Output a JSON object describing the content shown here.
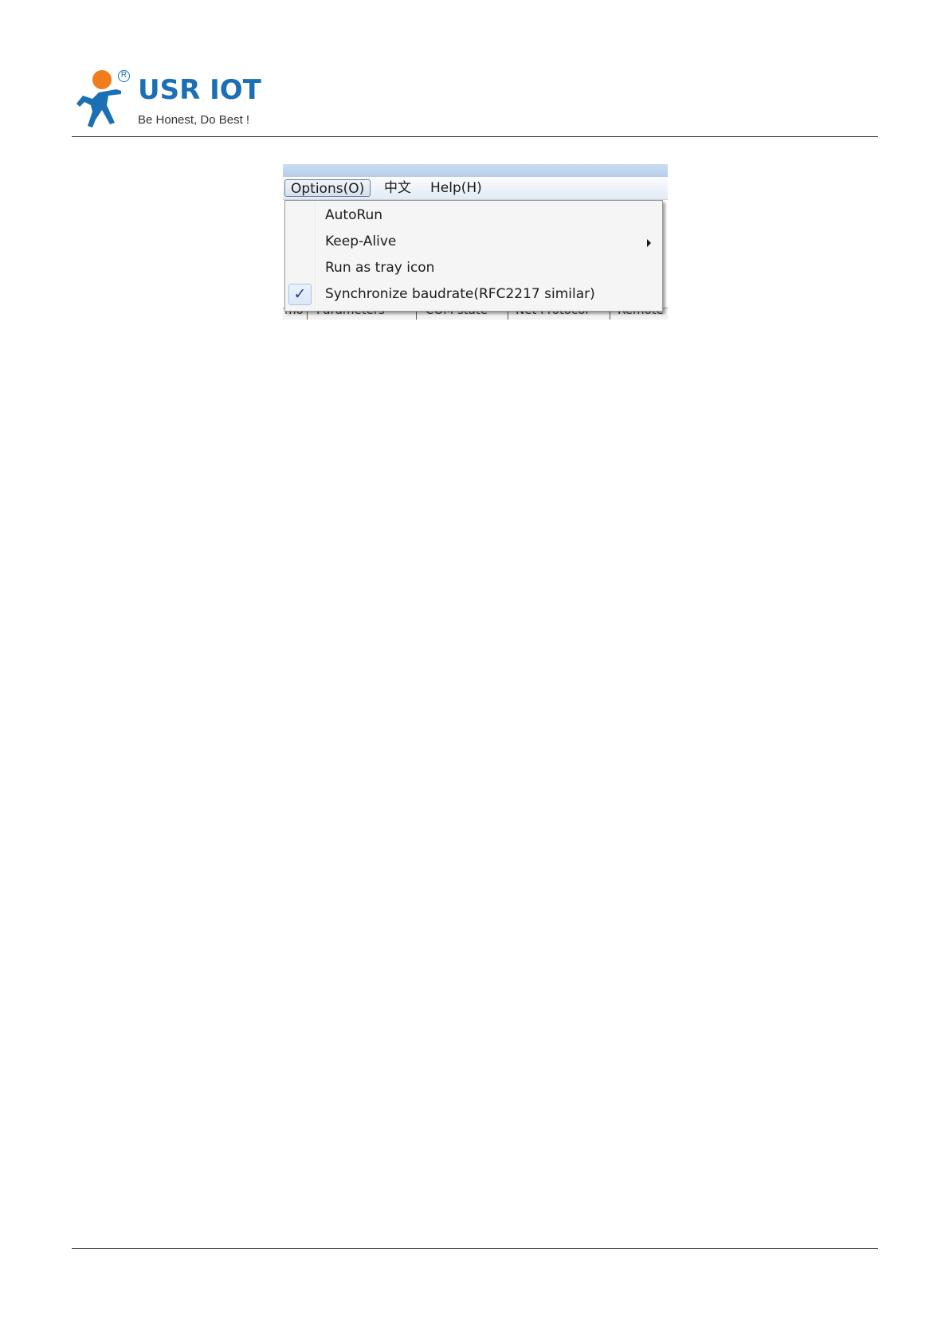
{
  "header": {
    "brand": "USR IOT",
    "registered_mark": "R",
    "tagline": "Be Honest, Do Best !"
  },
  "colors": {
    "brand_blue": "#1a6fb5",
    "brand_orange": "#f07c1b"
  },
  "app": {
    "menubar": {
      "items": [
        {
          "label": "Options(O)",
          "active": true
        },
        {
          "label": "中文"
        },
        {
          "label": "Help(H)"
        }
      ]
    },
    "options_menu": {
      "items": [
        {
          "label": "AutoRun",
          "checked": false,
          "submenu": false
        },
        {
          "label": "Keep-Alive",
          "checked": false,
          "submenu": true,
          "submenu_icon": "chevron-right-icon"
        },
        {
          "label": "Run as tray icon",
          "checked": false,
          "submenu": false
        },
        {
          "label": "Synchronize baudrate(RFC2217 similar)",
          "checked": true,
          "check_glyph": "✓",
          "submenu": false
        }
      ]
    },
    "background_tabs": {
      "items": [
        {
          "label": "mo"
        },
        {
          "label": "Parameters"
        },
        {
          "label": "COM state"
        },
        {
          "label": "Net Protocol"
        },
        {
          "label": "Remote"
        }
      ]
    }
  }
}
